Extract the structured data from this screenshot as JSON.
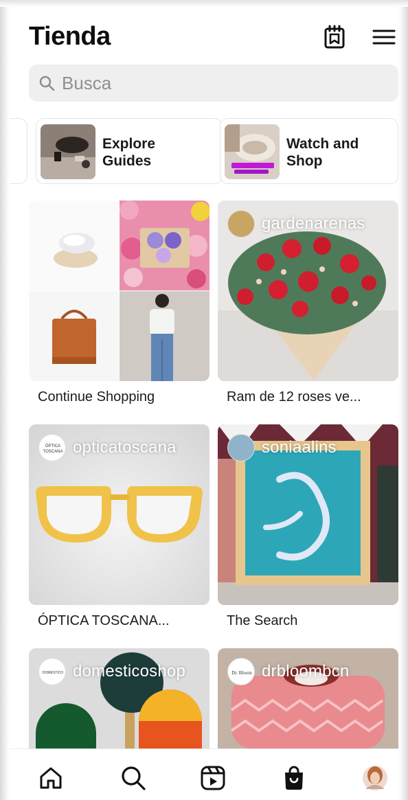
{
  "header": {
    "title": "Tienda",
    "calendar_icon": "saved-collections-icon",
    "menu_icon": "hamburger-menu-icon"
  },
  "search": {
    "placeholder": "Busca",
    "icon": "search-icon"
  },
  "guides": [
    {
      "label_line1": "Explore",
      "label_line2": "Guides"
    },
    {
      "label_line1": "Watch and",
      "label_line2": "Shop"
    }
  ],
  "grid": [
    {
      "caption": "Continue Shopping"
    },
    {
      "shop": "gardenarenas",
      "caption": "Ram de 12 roses ve..."
    },
    {
      "shop": "opticatoscana",
      "avatar_text": "ÓPTICA TOSCANA",
      "caption": "ÓPTICA TOSCANA..."
    },
    {
      "shop": "soniaalins",
      "caption": "The Search"
    },
    {
      "shop": "domesticoshop",
      "avatar_text": "DOMESTICO"
    },
    {
      "shop": "drbloombcn",
      "avatar_text": "Dr. Bloom"
    }
  ],
  "bottom_nav": {
    "items": [
      "home-icon",
      "search-icon",
      "reels-icon",
      "shop-icon",
      "profile-avatar"
    ],
    "active": "shop-icon"
  },
  "colors": {
    "text": "#111111",
    "search_bg": "#efefef",
    "caption": "#1c1c1c",
    "border": "#e4e4e4"
  }
}
